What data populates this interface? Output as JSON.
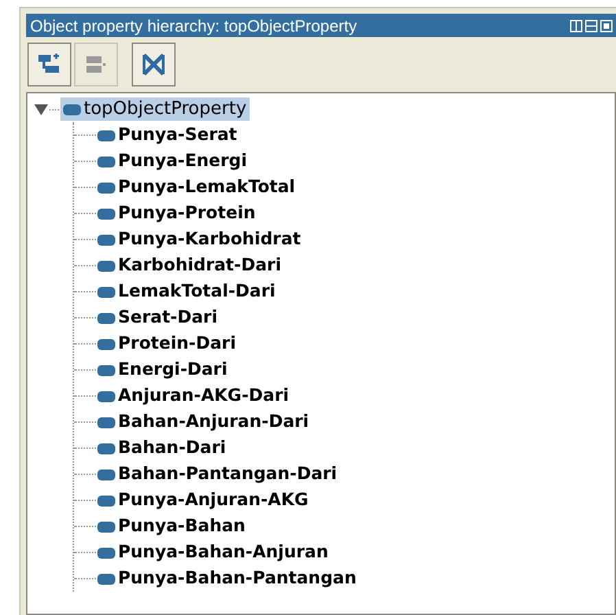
{
  "panel": {
    "title": "Object property hierarchy: topObjectProperty"
  },
  "toolbar": [
    {
      "kind": "add-sub",
      "disabled": false
    },
    {
      "kind": "add-sibling",
      "disabled": true
    },
    {
      "kind": "delete",
      "disabled": false
    }
  ],
  "tree": {
    "label": "topObjectProperty",
    "selected": true,
    "expanded": true,
    "children": [
      {
        "label": "Punya-Serat",
        "selected": false
      },
      {
        "label": "Punya-Energi",
        "selected": false
      },
      {
        "label": "Punya-LemakTotal",
        "selected": false
      },
      {
        "label": "Punya-Protein",
        "selected": false
      },
      {
        "label": "Punya-Karbohidrat",
        "selected": false
      },
      {
        "label": "Karbohidrat-Dari",
        "selected": false
      },
      {
        "label": "LemakTotal-Dari",
        "selected": false
      },
      {
        "label": "Serat-Dari",
        "selected": false
      },
      {
        "label": "Protein-Dari",
        "selected": false
      },
      {
        "label": "Energi-Dari",
        "selected": false
      },
      {
        "label": "Anjuran-AKG-Dari",
        "selected": false
      },
      {
        "label": "Bahan-Anjuran-Dari",
        "selected": false
      },
      {
        "label": "Bahan-Dari",
        "selected": false
      },
      {
        "label": "Bahan-Pantangan-Dari",
        "selected": false
      },
      {
        "label": "Punya-Anjuran-AKG",
        "selected": false
      },
      {
        "label": "Punya-Bahan",
        "selected": false
      },
      {
        "label": "Punya-Bahan-Anjuran",
        "selected": false
      },
      {
        "label": "Punya-Bahan-Pantangan",
        "selected": false
      }
    ]
  }
}
